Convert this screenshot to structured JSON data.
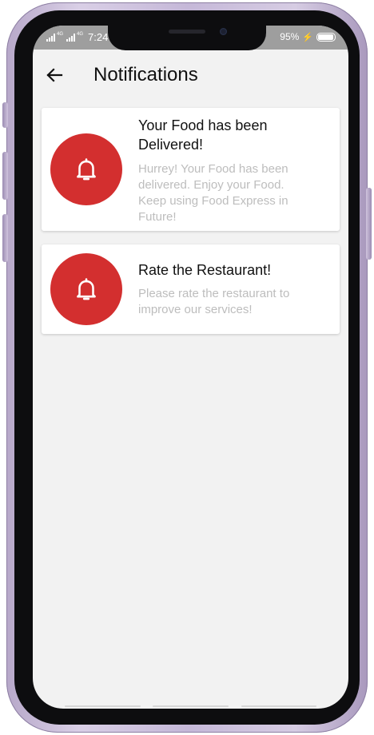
{
  "status_bar": {
    "network_1": "4G",
    "network_2": "4G",
    "time": "7:24",
    "battery": "95%",
    "battery_level": 0.95
  },
  "app_bar": {
    "back_icon": "arrow-left-icon",
    "title": "Notifications"
  },
  "notifications": [
    {
      "icon": "bell-icon",
      "title": "Your Food has been Delivered!",
      "body": "Hurrey! Your Food has been delivered. Enjoy your Food. Keep using Food Express in Future!"
    },
    {
      "icon": "bell-icon",
      "title": "Rate the Restaurant!",
      "body": "Please rate the restaurant to improve our services!"
    }
  ],
  "colors": {
    "accent": "#d32f2f",
    "background": "#f2f2f2",
    "status_bar": "#9e9e9e",
    "body_text": "#bdbdbd"
  }
}
